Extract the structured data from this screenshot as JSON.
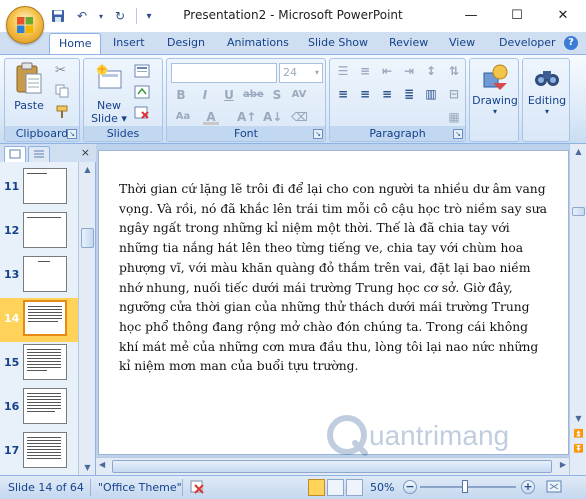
{
  "window": {
    "title": "Presentation2 - Microsoft PowerPoint",
    "minimize_glyph": "—",
    "maximize_glyph": "☐",
    "close_glyph": "✕"
  },
  "quick_access": {
    "undo_glyph": "↶",
    "redo_glyph": "↻",
    "more_glyph": "▾"
  },
  "tabs": [
    {
      "label": "Home",
      "active": true
    },
    {
      "label": "Insert"
    },
    {
      "label": "Design"
    },
    {
      "label": "Animations"
    },
    {
      "label": "Slide Show"
    },
    {
      "label": "Review"
    },
    {
      "label": "View"
    },
    {
      "label": "Developer"
    }
  ],
  "ribbon": {
    "clipboard": {
      "group_label": "Clipboard",
      "paste_label": "Paste"
    },
    "slides": {
      "group_label": "Slides",
      "new_slide_label": "New",
      "new_slide_label2": "Slide ▾"
    },
    "font": {
      "group_label": "Font",
      "font_name_value": "",
      "font_size_value": "24",
      "bold": "B",
      "italic": "I",
      "underline": "U",
      "strike": "abe",
      "shadow": "S",
      "spacing": "AV",
      "case": "Aa",
      "color": "A"
    },
    "paragraph": {
      "group_label": "Paragraph"
    },
    "drawing": {
      "label": "Drawing"
    },
    "editing": {
      "label": "Editing"
    }
  },
  "slide_panel": {
    "close_glyph": "×",
    "slides": [
      {
        "number": "11",
        "selected": false
      },
      {
        "number": "12",
        "selected": false
      },
      {
        "number": "13",
        "selected": false
      },
      {
        "number": "14",
        "selected": true
      },
      {
        "number": "15",
        "selected": false
      },
      {
        "number": "16",
        "selected": false
      },
      {
        "number": "17",
        "selected": false
      }
    ]
  },
  "slide": {
    "body_text": "Thời gian cứ lặng lẽ trôi đi để lại cho con người ta nhiều dư âm vang vọng. Và rồi, nó đã khắc lên trái tim mỗi cô cậu học trò niềm say sưa ngây ngất trong những kỉ niệm một thời. Thế là đã chia tay với những tia nắng hát lên theo từng tiếng ve, chia tay với chùm hoa phượng vĩ, với màu khăn quàng đỏ thắm trên vai, đặt lại bao niềm nhớ nhung, nuối tiếc dưới mái trường Trung  học cơ sở. Giờ đây, ngưỡng cửa thời gian của những thử thách dưới mái trường Trung học phổ thông đang rộng mở chào đón chúng ta. Trong cái không khí mát mẻ của những cơn mưa đầu thu, lòng tôi lại nao nức những kỉ niệm mơn man của buổi tựu trường."
  },
  "watermark": {
    "text": "uantrimang"
  },
  "status": {
    "slide_position": "Slide 14 of 64",
    "theme": "\"Office Theme\"",
    "zoom": "50%",
    "zoom_fraction": 0.47,
    "zoom_minus": "−",
    "zoom_plus": "+"
  },
  "colors": {
    "accent": "#15428b",
    "ribbon_border": "#8db2e3",
    "selected_thumb": "#ffd35a"
  }
}
